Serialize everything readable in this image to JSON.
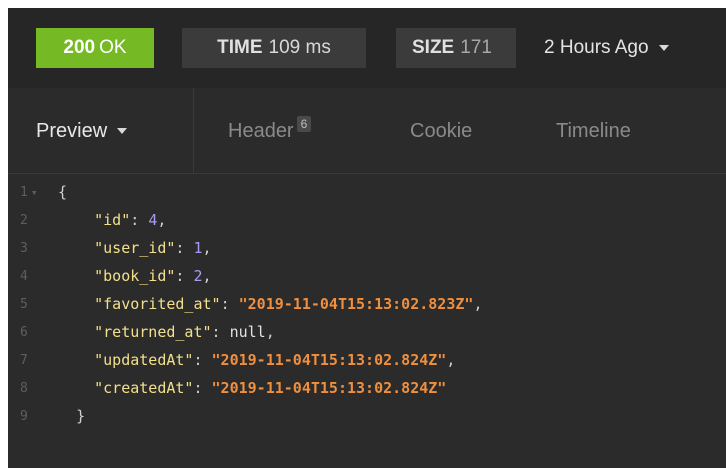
{
  "status_bar": {
    "status_code": "200",
    "status_text": "OK",
    "time_label": "TIME",
    "time_value": "109 ms",
    "size_label": "SIZE",
    "size_value": "171",
    "history": "2 Hours Ago",
    "colors": {
      "status_ok": "#75ba24",
      "pill_bg": "#3b3b3b"
    }
  },
  "tabs": {
    "preview": "Preview",
    "header": "Header",
    "header_count": "6",
    "cookie": "Cookie",
    "timeline": "Timeline"
  },
  "code": {
    "lines": [
      {
        "n": "1",
        "open": "{"
      },
      {
        "n": "2",
        "key": "\"id\"",
        "num": "4"
      },
      {
        "n": "3",
        "key": "\"user_id\"",
        "num": "1"
      },
      {
        "n": "4",
        "key": "\"book_id\"",
        "num": "2"
      },
      {
        "n": "5",
        "key": "\"favorited_at\"",
        "str": "\"2019-11-04T15:13:02.823Z\""
      },
      {
        "n": "6",
        "key": "\"returned_at\"",
        "nul": "null"
      },
      {
        "n": "7",
        "key": "\"updatedAt\"",
        "str": "\"2019-11-04T15:13:02.824Z\""
      },
      {
        "n": "8",
        "key": "\"createdAt\"",
        "str": "\"2019-11-04T15:13:02.824Z\""
      },
      {
        "n": "9",
        "close": "}"
      }
    ]
  }
}
